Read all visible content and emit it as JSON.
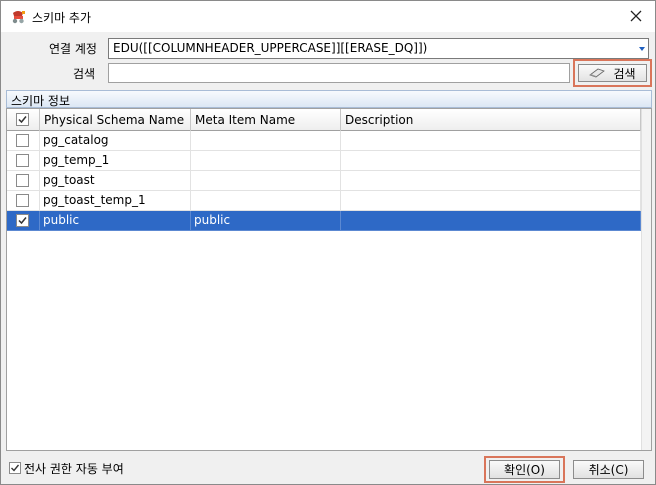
{
  "window": {
    "title": "스키마 추가",
    "icon": "schema-app-icon",
    "close_icon": "close-icon"
  },
  "form": {
    "connection_label": "연결 계정",
    "connection_value": "EDU([[COLUMNHEADER_UPPERCASE]][[ERASE_DQ]])",
    "search_label": "검색",
    "search_value": "",
    "search_button_label": "검색"
  },
  "section": {
    "title": "스키마 정보"
  },
  "grid": {
    "columns": [
      "Physical Schema Name",
      "Meta Item Name",
      "Description"
    ],
    "header_checked": true,
    "rows": [
      {
        "checked": false,
        "physical": "pg_catalog",
        "meta": "",
        "description": "",
        "selected": false
      },
      {
        "checked": false,
        "physical": "pg_temp_1",
        "meta": "",
        "description": "",
        "selected": false
      },
      {
        "checked": false,
        "physical": "pg_toast",
        "meta": "",
        "description": "",
        "selected": false
      },
      {
        "checked": false,
        "physical": "pg_toast_temp_1",
        "meta": "",
        "description": "",
        "selected": false
      },
      {
        "checked": true,
        "physical": "public",
        "meta": "public",
        "description": "",
        "selected": true
      }
    ]
  },
  "footer": {
    "grant_label": "전사 권한 자동 부여",
    "grant_checked": true,
    "ok_label": "확인(O)",
    "cancel_label": "취소(C)"
  },
  "colors": {
    "selection": "#2e69c6",
    "highlight_outline": "#d9755a"
  }
}
